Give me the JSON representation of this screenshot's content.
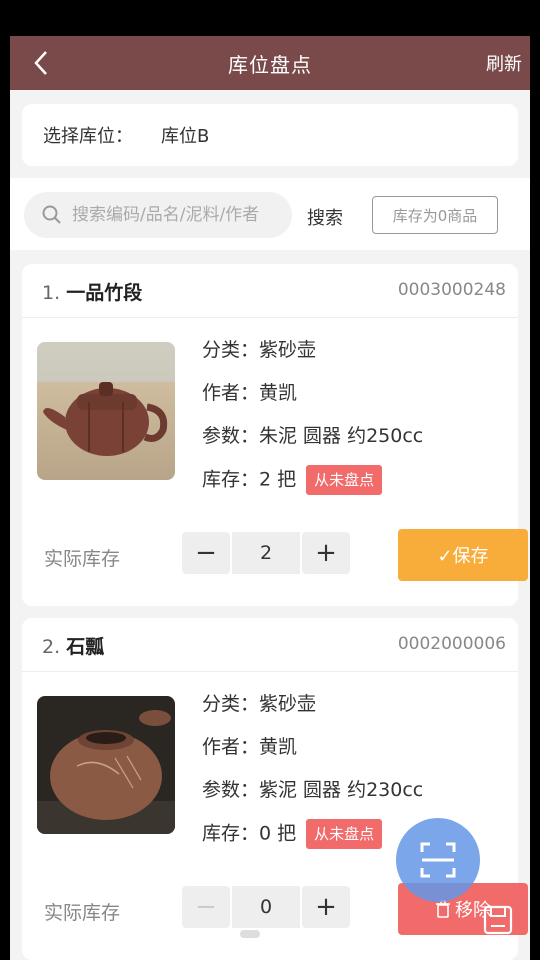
{
  "header": {
    "title": "库位盘点",
    "refresh_label": "刷新"
  },
  "location": {
    "label": "选择库位：",
    "value": "库位B"
  },
  "search": {
    "placeholder": "搜索编码/品名/泥料/作者",
    "button_label": "搜索",
    "zero_stock_label": "库存为0商品"
  },
  "items": [
    {
      "index": "1.",
      "name": "一品竹段",
      "code": "0003000248",
      "category": "分类：紫砂壶",
      "author": "作者：黄凯",
      "params": "参数：朱泥  圆器  约250cc",
      "stock": "库存：2 把",
      "status_badge": "从未盘点",
      "actual_label": "实际库存",
      "actual_value": "2",
      "action_label": "✓保存"
    },
    {
      "index": "2.",
      "name": "石瓢",
      "code": "0002000006",
      "category": "分类：紫砂壶",
      "author": "作者：黄凯",
      "params": "参数：紫泥  圆器  约230cc",
      "stock": "库存：0 把",
      "status_badge": "从未盘点",
      "actual_label": "实际库存",
      "actual_value": "0",
      "action_label": "移除"
    }
  ],
  "colors": {
    "header_bg": "#7a4a4a",
    "save_button": "#f8ac3a",
    "remove_button": "#f26b6b",
    "badge": "#f26b6b",
    "scan_fab": "#6496e6"
  },
  "icons": {
    "back": "chevron-left-icon",
    "search": "search-icon",
    "scan": "scan-icon",
    "trash": "trash-icon",
    "save": "save-icon"
  }
}
